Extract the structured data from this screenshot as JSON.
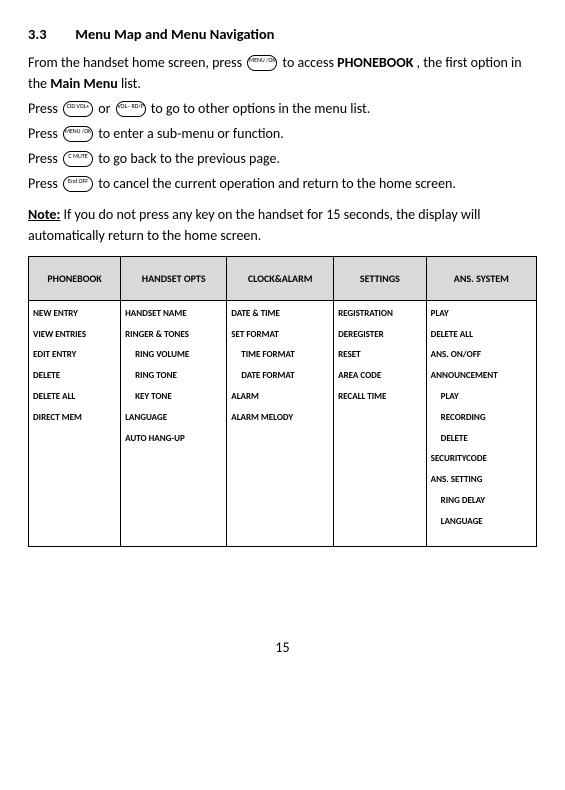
{
  "section": {
    "number": "3.3",
    "title": "Menu Map and Menu Navigation"
  },
  "paragraphs": {
    "intro_part1": "From the handset home screen, press ",
    "intro_part2": " to access ",
    "intro_phonebook": "PHONEBOOK",
    "intro_part3": ", the first option in the ",
    "intro_mainmenu": "Main Menu",
    "intro_part4": " list.",
    "line2_a": "Press ",
    "line2_b": " or ",
    "line2_c": " to go to other options in the menu list.",
    "line3_a": "Press ",
    "line3_b": " to enter a sub-menu or function.",
    "line4_a": "Press ",
    "line4_b": " to go back to the previous page.",
    "line5_a": "Press ",
    "line5_b": " to cancel the current operation and return to the home screen.",
    "note_label": "Note:",
    "note_body": " If you do not press any key on the handset for 15 seconds, the display will automatically return to the home screen."
  },
  "keys": {
    "menu_ok": "MENU\n/OK",
    "vol_up": "CID\nVOL+",
    "vol_down": "VOL−\nRD/P",
    "mute": "C\nMUTE",
    "end": "End\nOFF"
  },
  "table": {
    "headers": [
      "PHONEBOOK",
      "HANDSET OPTS",
      "CLOCK&ALARM",
      "SETTINGS",
      "ANS. SYSTEM"
    ],
    "columns": [
      [
        {
          "text": "NEW ENTRY",
          "indent": 0
        },
        {
          "text": "VIEW ENTRIES",
          "indent": 0
        },
        {
          "text": "EDIT ENTRY",
          "indent": 0
        },
        {
          "text": "DELETE",
          "indent": 0
        },
        {
          "text": "DELETE ALL",
          "indent": 0
        },
        {
          "text": "DIRECT MEM",
          "indent": 0
        }
      ],
      [
        {
          "text": "HANDSET NAME",
          "indent": 0
        },
        {
          "text": "RINGER & TONES",
          "indent": 0
        },
        {
          "text": "RING VOLUME",
          "indent": 1
        },
        {
          "text": "RING TONE",
          "indent": 1
        },
        {
          "text": "KEY TONE",
          "indent": 1
        },
        {
          "text": "LANGUAGE",
          "indent": 0
        },
        {
          "text": "AUTO HANG-UP",
          "indent": 0
        }
      ],
      [
        {
          "text": "DATE & TIME",
          "indent": 0
        },
        {
          "text": "SET FORMAT",
          "indent": 0
        },
        {
          "text": "TIME FORMAT",
          "indent": 1
        },
        {
          "text": "DATE FORMAT",
          "indent": 1
        },
        {
          "text": "ALARM",
          "indent": 0
        },
        {
          "text": "ALARM MELODY",
          "indent": 0
        }
      ],
      [
        {
          "text": "REGISTRATION",
          "indent": 0
        },
        {
          "text": "DEREGISTER",
          "indent": 0
        },
        {
          "text": "RESET",
          "indent": 0
        },
        {
          "text": "AREA CODE",
          "indent": 0
        },
        {
          "text": "RECALL TIME",
          "indent": 0
        }
      ],
      [
        {
          "text": "PLAY",
          "indent": 0
        },
        {
          "text": "DELETE ALL",
          "indent": 0
        },
        {
          "text": "ANS. ON/OFF",
          "indent": 0
        },
        {
          "text": "ANNOUNCEMENT",
          "indent": 0
        },
        {
          "text": "PLAY",
          "indent": 1
        },
        {
          "text": "RECORDING",
          "indent": 1
        },
        {
          "text": "DELETE",
          "indent": 1
        },
        {
          "text": "SECURITYCODE",
          "indent": 0
        },
        {
          "text": "ANS. SETTING",
          "indent": 0
        },
        {
          "text": "RING DELAY",
          "indent": 1
        },
        {
          "text": "LANGUAGE",
          "indent": 1
        }
      ]
    ]
  },
  "page_number": "15"
}
